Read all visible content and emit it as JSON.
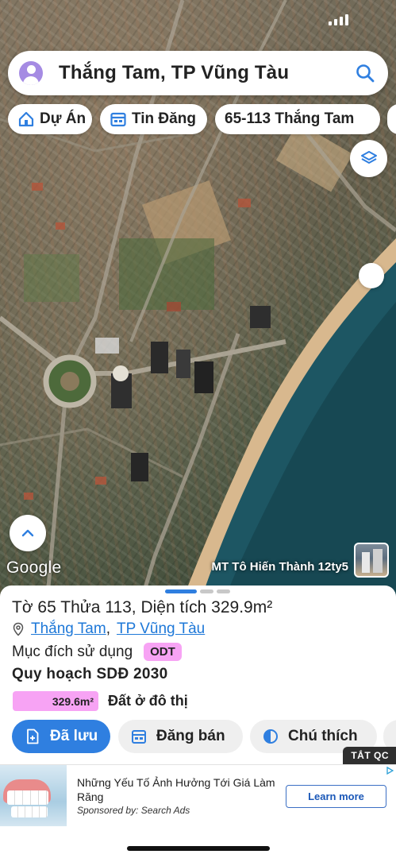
{
  "search": {
    "title": "Thắng Tam, TP Vũng Tàu"
  },
  "chips": [
    {
      "label": "Dự Án",
      "icon": "home-icon"
    },
    {
      "label": "Tin Đăng",
      "icon": "calendar-icon"
    },
    {
      "label": "65-113 Thắng Tam"
    }
  ],
  "map": {
    "attribution": "Google",
    "caption": "MT Tô Hiến Thành 12ty5"
  },
  "parcel": {
    "title": "Tờ 65 Thửa 113, Diện tích 329.9m²",
    "ward": "Thắng Tam",
    "separator": ",",
    "city": "TP Vũng Tàu",
    "purpose_label": "Mục đích sử dụng",
    "purpose_code": "ODT",
    "plan_title": "Quy hoạch SDĐ 2030",
    "plan_area": "329.6m²",
    "plan_land_type": "Đất ở đô thị",
    "plan_color": "#f7a3f4"
  },
  "actions": {
    "saved": "Đã lưu",
    "sell": "Đăng bán",
    "legend": "Chú thích"
  },
  "ad": {
    "close_label": "TẮT QC",
    "title": "Những Yếu Tố Ảnh Hưởng Tới Giá Làm Răng",
    "sponsor": "Sponsored by: Search Ads",
    "cta": "Learn more"
  },
  "colors": {
    "accent": "#2f7fe0",
    "badge": "#f7a3f4"
  }
}
